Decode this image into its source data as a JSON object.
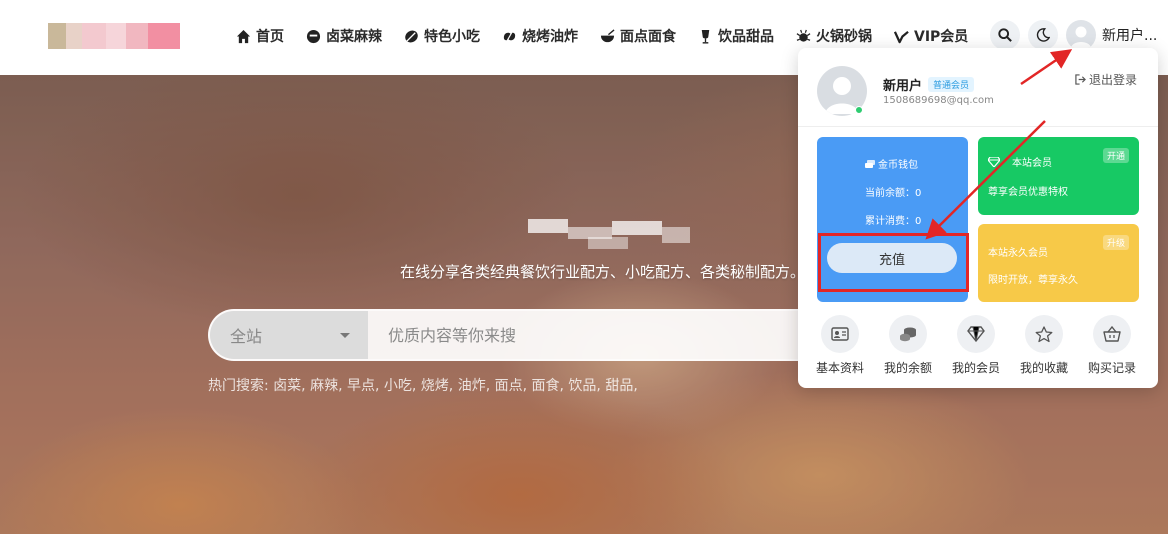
{
  "nav": {
    "items": [
      {
        "label": "首页",
        "icon": "home-icon"
      },
      {
        "label": "卤菜麻辣",
        "icon": "smile-icon"
      },
      {
        "label": "特色小吃",
        "icon": "leaf-icon"
      },
      {
        "label": "烧烤油炸",
        "icon": "grill-icon"
      },
      {
        "label": "面点面食",
        "icon": "bowl-icon"
      },
      {
        "label": "饮品甜品",
        "icon": "drink-icon"
      },
      {
        "label": "火锅砂锅",
        "icon": "hotpot-icon"
      },
      {
        "label": "VIP会员",
        "icon": "vip-icon"
      }
    ],
    "user_name": "新用户..."
  },
  "hero": {
    "subtitle": "在线分享各类经典餐饮行业配方、小吃配方、各类秘制配方。",
    "search_scope": "全站",
    "search_placeholder": "优质内容等你来搜",
    "hot_label": "热门搜索:",
    "hot_terms": [
      "卤菜",
      "麻辣",
      "早点",
      "小吃",
      "烧烤",
      "油炸",
      "面点",
      "面食",
      "饮品",
      "甜品"
    ]
  },
  "dropdown": {
    "name": "新用户",
    "badge": "普通会员",
    "email": "1508689698@qq.com",
    "logout": "退出登录",
    "wallet": {
      "title": "金币钱包",
      "balance": "当前余额：0",
      "spent": "累计消费：0",
      "recharge": "充值"
    },
    "vip": {
      "title": "本站会员",
      "desc": "尊享会员优惠特权",
      "tag": "开通"
    },
    "permanent": {
      "title": "本站永久会员",
      "desc": "限时开放，尊享永久",
      "tag": "升级"
    },
    "quick_links": [
      {
        "label": "基本资料",
        "icon": "id-card-icon"
      },
      {
        "label": "我的余额",
        "icon": "coins-icon"
      },
      {
        "label": "我的会员",
        "icon": "diamond-icon"
      },
      {
        "label": "我的收藏",
        "icon": "star-icon"
      },
      {
        "label": "购买记录",
        "icon": "basket-icon"
      }
    ]
  },
  "colors": {
    "wallet_card": "#4a9bf5",
    "vip_card": "#17c964",
    "permanent_card": "#f7c948",
    "annotation": "#e22626"
  }
}
